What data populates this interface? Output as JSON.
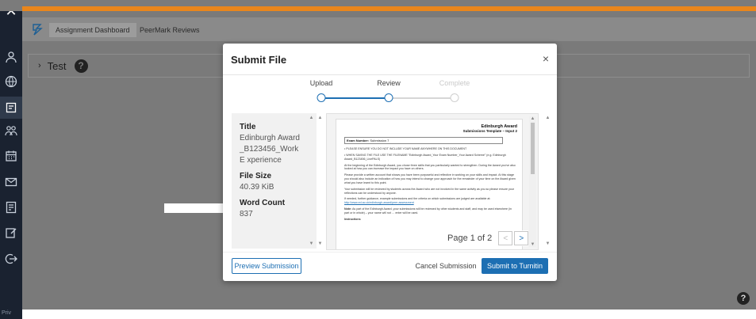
{
  "tabs": {
    "assignment_dashboard": "Assignment Dashboard",
    "peermark_reviews": "PeerMark Reviews"
  },
  "section": {
    "title": "Test"
  },
  "nav": {
    "footer": "Priv"
  },
  "modal": {
    "title": "Submit File",
    "steps": [
      {
        "label": "Upload",
        "state": "completed"
      },
      {
        "label": "Review",
        "state": "current"
      },
      {
        "label": "Complete",
        "state": "upcoming"
      }
    ],
    "info": {
      "title_label": "Title",
      "title_value": "Edinburgh Award _B123456_Work E xperience",
      "file_size_label": "File Size",
      "file_size_value": "40.39 KiB",
      "word_count_label": "Word Count",
      "word_count_value": "837"
    },
    "preview": {
      "org": "Edinburgh Award",
      "subtitle": "Submissions Template – Input 2",
      "exam_number_label": "Exam Number:",
      "exam_number_value": "Submission 7",
      "bullet_1": "•  PLEASE ENSURE YOU DO NOT INCLUDE YOUR NAME ANYWHERE ON THIS DOCUMENT",
      "bullet_2": "•  WHEN SAVING THE FILE USE THE FILENAME \"Edinburgh Award_Your Exam Number_Your Award Scheme\" (e.g. Edinburgh Award_B123456_LivePALS)",
      "para_1": "At the beginning of the Edinburgh Award, you chose three skills that you particularly wanted to strengthen. During the Award you've also looked at how you can increase the impact you have on others.",
      "para_2": "Please provide a written account that shows you have been purposeful and reflective in working on your skills and impact. At this stage you should also include an indication of how you may intend to change your approach for the remainder of your time on the Award given what you have learnt to this point.",
      "para_3": "Your submission will be reviewed by students across the Award who are not involved in the same activity as you so please ensure your reflections can be understood by anyone.",
      "para_4": "If needed, further guidance, example submissions and the criteria on which submissions are judged are available at:",
      "para_4_link": "http://www.ed.ac.uk/edinburgh-award/peer-assessment",
      "note_label": "Note:",
      "note_text": "As part of the Edinburgh Award, your submissions will be reviewed by other students and staff, and may be used elsewhere (in part or in whole) – your name will not …",
      "note_end": "enter will be used.",
      "instructions": "Instructions"
    },
    "pager": {
      "text": "Page 1 of 2",
      "prev": "<",
      "next": ">"
    },
    "buttons": {
      "preview": "Preview Submission",
      "cancel": "Cancel Submission",
      "submit": "Submit to Turnitin"
    },
    "close": "×"
  },
  "colors": {
    "accent_orange": "#e9861c",
    "primary_blue": "#1d6fb3",
    "nav_dark": "#1a2230"
  }
}
